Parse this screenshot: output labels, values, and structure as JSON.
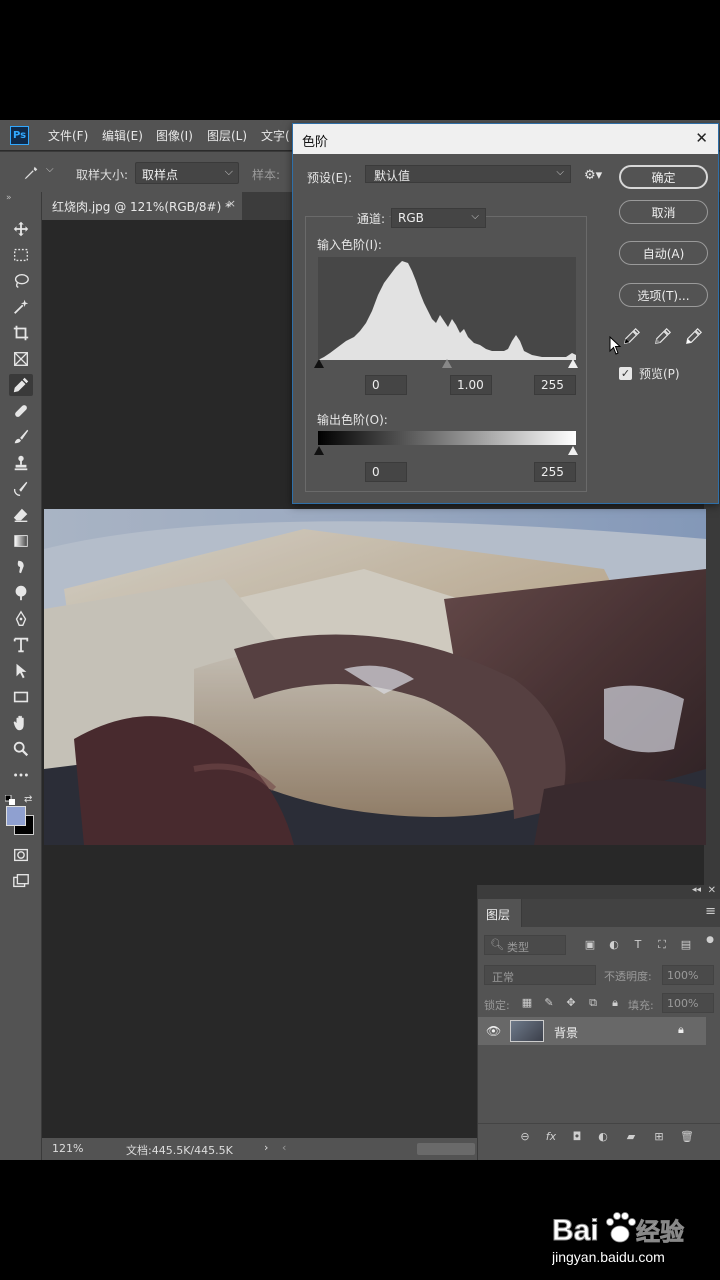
{
  "app": {
    "logo_text": "Ps",
    "menus": [
      "文件(F)",
      "编辑(E)",
      "图像(I)",
      "图层(L)",
      "文字("
    ]
  },
  "options_bar": {
    "sample_size_label": "取样大小:",
    "sample_size_value": "取样点",
    "sample_label": "样本:"
  },
  "document": {
    "tab_title": "红烧肉.jpg @ 121%(RGB/8#) *",
    "close_glyph": "×"
  },
  "status_bar": {
    "zoom": "121%",
    "doc_info": "文档:445.5K/445.5K",
    "arrow": "›",
    "left_arrow": "‹"
  },
  "levels_dialog": {
    "title": "色阶",
    "preset_label": "预设(E):",
    "preset_value": "默认值",
    "channel_label": "通道:",
    "channel_value": "RGB",
    "input_label": "输入色阶(I):",
    "input_black": "0",
    "input_gamma": "1.00",
    "input_white": "255",
    "output_label": "输出色阶(O):",
    "output_black": "0",
    "output_white": "255",
    "ok_button": "确定",
    "cancel_button": "取消",
    "auto_button": "自动(A)",
    "options_button": "选项(T)...",
    "preview_label": "预览(P)",
    "preview_checked": true
  },
  "layers_panel": {
    "tab_label": "图层",
    "filter_placeholder": "类型",
    "blend_mode": "正常",
    "opacity_label": "不透明度:",
    "opacity_value": "100%",
    "lock_label": "锁定:",
    "fill_label": "填充:",
    "fill_value": "100%",
    "layers": [
      {
        "name": "背景",
        "visible": true,
        "locked": true
      }
    ]
  },
  "watermark": {
    "brand": "Bai",
    "brand2": "经验",
    "url": "jingyan.baidu.com"
  },
  "colors": {
    "ps_blue": "#31a8ff",
    "dialog_border": "#2e6fa8",
    "foreground_swatch": "#8fa0d0",
    "background_swatch": "#000000"
  }
}
